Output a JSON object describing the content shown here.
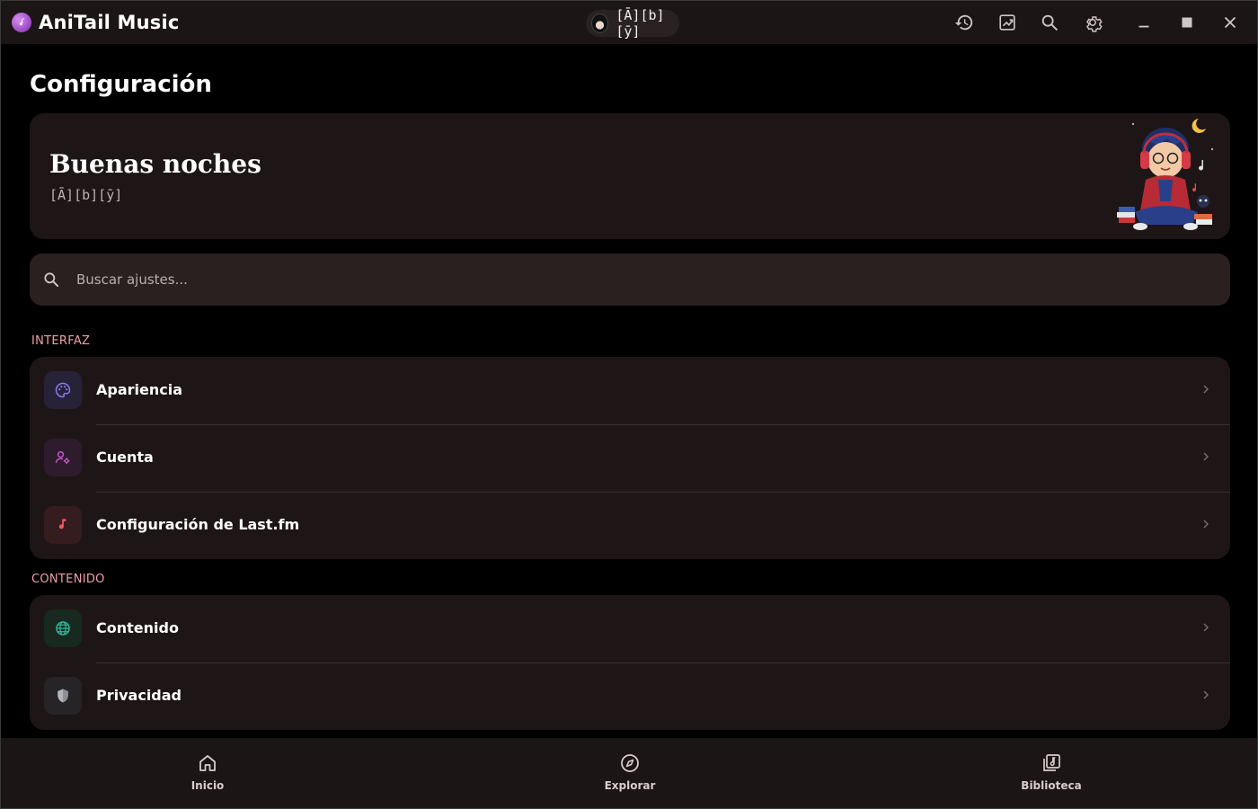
{
  "app": {
    "title": "AniTail Music",
    "user_chip_name": "[Ā][b][ȳ]"
  },
  "titlebar_icons": [
    "history-icon",
    "trending-icon",
    "search-icon",
    "settings-icon",
    "minimize-icon",
    "maximize-icon",
    "close-icon"
  ],
  "page": {
    "title": "Configuración"
  },
  "greeting": {
    "title": "Buenas noches",
    "username": "[Ā][b][ȳ]"
  },
  "search": {
    "placeholder": "Buscar ajustes..."
  },
  "sections": [
    {
      "label": "INTERFAZ",
      "items": [
        {
          "label": "Apariencia",
          "icon": "palette-icon",
          "color": "#8a7cf0",
          "bg": "#262238"
        },
        {
          "label": "Cuenta",
          "icon": "account-settings-icon",
          "color": "#c659c9",
          "bg": "#2e1c2c"
        },
        {
          "label": "Configuración de Last.fm",
          "icon": "music-note-icon",
          "color": "#f05a62",
          "bg": "#351c1e"
        }
      ]
    },
    {
      "label": "CONTENIDO",
      "items": [
        {
          "label": "Contenido",
          "icon": "globe-icon",
          "color": "#2fb89a",
          "bg": "#18291f"
        },
        {
          "label": "Privacidad",
          "icon": "shield-icon",
          "color": "#b4b4bc",
          "bg": "#262426"
        }
      ]
    }
  ],
  "bottom_nav": [
    {
      "label": "Inicio",
      "icon": "home-icon"
    },
    {
      "label": "Explorar",
      "icon": "compass-icon"
    },
    {
      "label": "Biblioteca",
      "icon": "library-icon"
    }
  ],
  "colors": {
    "accent_section": "#f0a0a8",
    "surface": "#1e1616",
    "titlebar": "#1c1515"
  }
}
